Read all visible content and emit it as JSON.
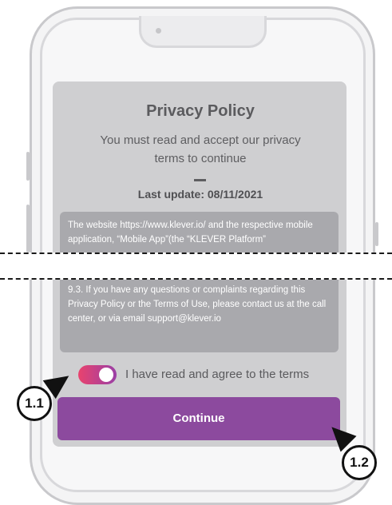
{
  "privacy": {
    "title": "Privacy Policy",
    "subtitle": "You must read and accept our privacy terms to continue",
    "last_update": "Last update: 08/11/2021",
    "policy_top": "The website https://www.klever.io/ and the respective mobile application, “Mobile App”(the “KLEVER Platform”",
    "policy_bottom": "9.3. If you have any questions or complaints regarding this Privacy Policy or the Terms of Use, please contact us at the call center, or via email support@klever.io"
  },
  "terms": {
    "toggle_checked": true,
    "label": "I have read and agree to the terms"
  },
  "buttons": {
    "continue_label": "Continue"
  },
  "callouts": {
    "toggle": "1.1",
    "continue": "1.2"
  },
  "colors": {
    "accent": "#8c4a9e",
    "toggle_start": "#e9436e",
    "toggle_end": "#9a3fa6"
  }
}
